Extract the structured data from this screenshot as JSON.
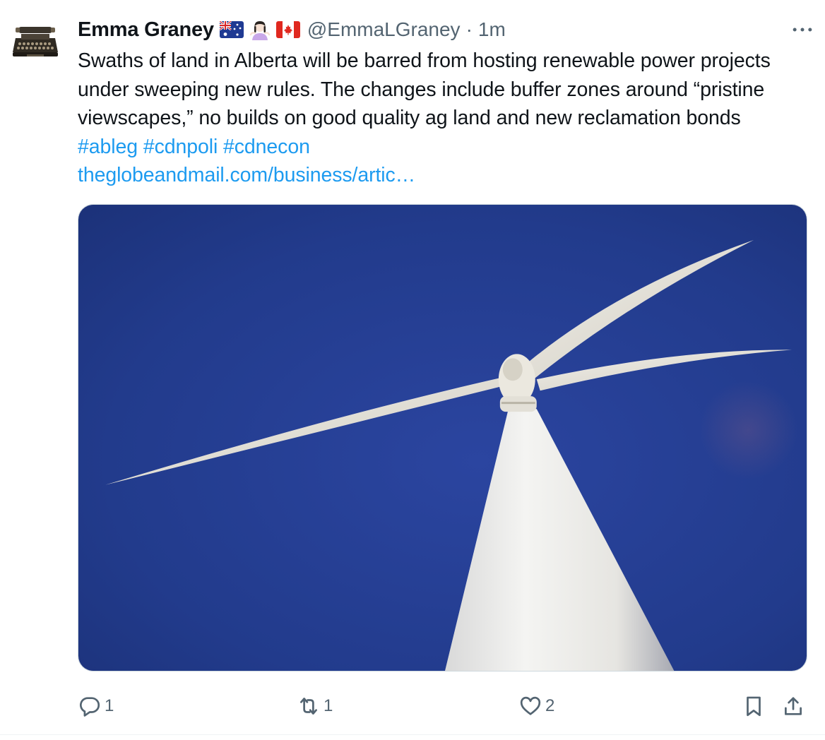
{
  "tweet": {
    "author": {
      "display_name": "Emma Graney",
      "handle": "@EmmaLGraney",
      "separator": "·",
      "timestamp": "1m",
      "badges": [
        "australia-flag-icon",
        "person-shrugging-icon",
        "canada-flag-icon"
      ]
    },
    "text": {
      "body": "Swaths of land in Alberta will be barred from hosting renewable power projects under sweeping new rules. The changes include buffer zones around “pristine viewscapes,” no builds on good quality ag land and new reclamation bonds ",
      "hashtags": [
        "#ableg",
        "#cdnpoli",
        "#cdnecon"
      ],
      "link": "theglobeandmail.com/business/artic…"
    },
    "actions": {
      "reply_count": "1",
      "retweet_count": "1",
      "like_count": "2"
    }
  },
  "colors": {
    "accent": "#1d9bf0",
    "text_primary": "#0f1419",
    "text_secondary": "#536471",
    "media_sky": "#233a86"
  }
}
